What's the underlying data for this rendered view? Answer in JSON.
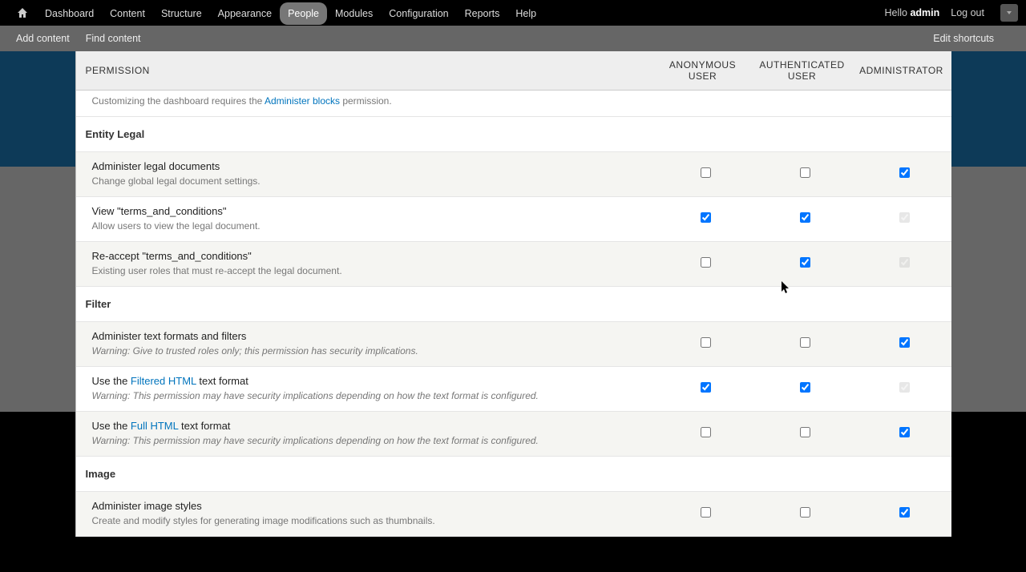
{
  "toolbar": {
    "menu": [
      "Dashboard",
      "Content",
      "Structure",
      "Appearance",
      "People",
      "Modules",
      "Configuration",
      "Reports",
      "Help"
    ],
    "active_index": 4,
    "hello_prefix": "Hello ",
    "username": "admin",
    "logout": "Log out"
  },
  "shortcuts": {
    "links": [
      "Add content",
      "Find content"
    ],
    "edit": "Edit shortcuts"
  },
  "columns": {
    "permission": "PERMISSION",
    "anon": "ANONYMOUS USER",
    "auth": "AUTHENTICATED USER",
    "admin": "ADMINISTRATOR"
  },
  "rows": [
    {
      "kind": "partial",
      "desc_pre": "Customizing the dashboard requires the ",
      "desc_link": "Administer blocks",
      "desc_post": " permission.",
      "checks": {
        "anon": null,
        "auth": null,
        "admin": null
      }
    },
    {
      "kind": "module",
      "title": "Entity Legal"
    },
    {
      "kind": "perm",
      "stripe": "odd",
      "title": "Administer legal documents",
      "desc": "Change global legal document settings.",
      "checks": {
        "anon": false,
        "auth": false,
        "admin": true,
        "admin_locked": false
      }
    },
    {
      "kind": "perm",
      "stripe": "even",
      "title": "View \"terms_and_conditions\"",
      "desc": "Allow users to view the legal document.",
      "checks": {
        "anon": true,
        "auth": true,
        "admin": true,
        "admin_locked": true
      }
    },
    {
      "kind": "perm",
      "stripe": "odd",
      "title": "Re-accept \"terms_and_conditions\"",
      "desc": "Existing user roles that must re-accept the legal document.",
      "checks": {
        "anon": false,
        "auth": true,
        "admin": true,
        "admin_locked": true
      }
    },
    {
      "kind": "module",
      "title": "Filter"
    },
    {
      "kind": "perm",
      "stripe": "odd",
      "title": "Administer text formats and filters",
      "desc": "Warning: Give to trusted roles only; this permission has security implications.",
      "desc_italic": true,
      "checks": {
        "anon": false,
        "auth": false,
        "admin": true,
        "admin_locked": false
      }
    },
    {
      "kind": "perm",
      "stripe": "even",
      "title_parts": {
        "pre": "Use the ",
        "link": "Filtered HTML",
        "post": " text format"
      },
      "desc": "Warning: This permission may have security implications depending on how the text format is configured.",
      "desc_italic": true,
      "checks": {
        "anon": true,
        "auth": true,
        "admin": true,
        "admin_locked": true
      }
    },
    {
      "kind": "perm",
      "stripe": "odd",
      "title_parts": {
        "pre": "Use the ",
        "link": "Full HTML",
        "post": " text format"
      },
      "desc": "Warning: This permission may have security implications depending on how the text format is configured.",
      "desc_italic": true,
      "checks": {
        "anon": false,
        "auth": false,
        "admin": true,
        "admin_locked": false
      }
    },
    {
      "kind": "module",
      "title": "Image"
    },
    {
      "kind": "perm",
      "stripe": "odd",
      "title": "Administer image styles",
      "desc": "Create and modify styles for generating image modifications such as thumbnails.",
      "checks": {
        "anon": false,
        "auth": false,
        "admin": true,
        "admin_locked": false
      }
    }
  ]
}
